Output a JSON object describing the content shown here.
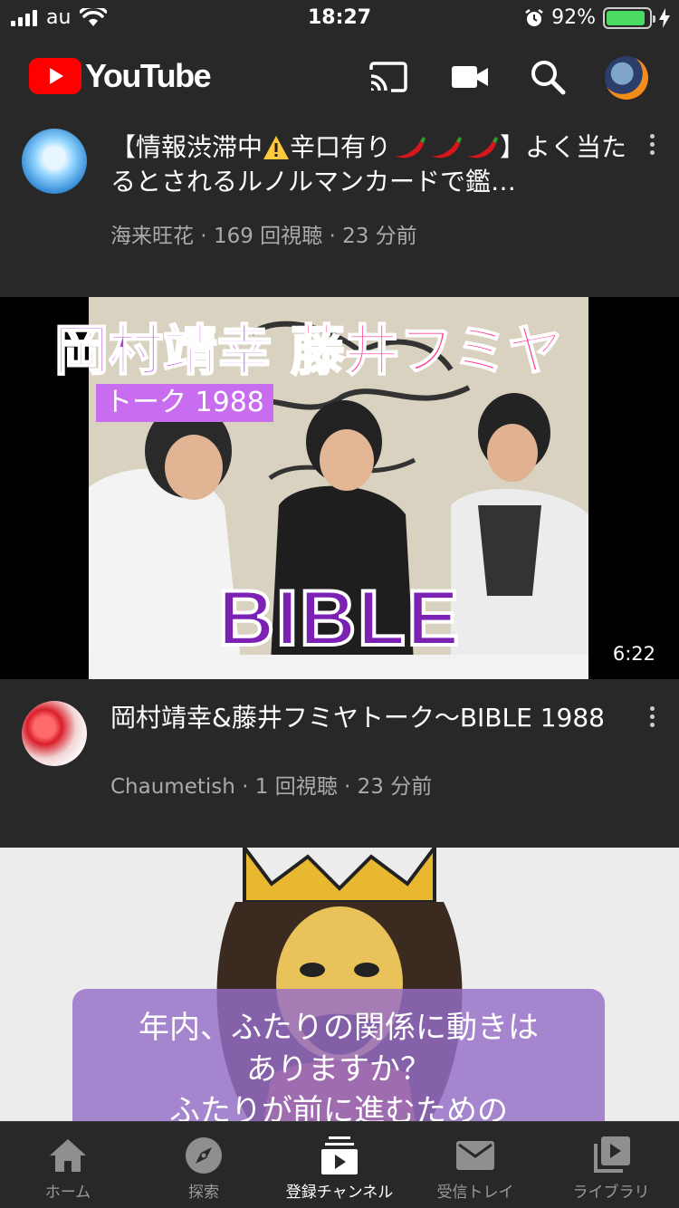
{
  "status_bar": {
    "carrier": "au",
    "time": "18:27",
    "battery_percent": "92%",
    "battery_level": 0.92
  },
  "header": {
    "logo_text": "YouTube",
    "icons": [
      "cast-icon",
      "camera-icon",
      "search-icon",
      "account-avatar"
    ]
  },
  "videos": [
    {
      "title_prefix": "【情報渋滞中",
      "title_mid": "辛口有り",
      "title_suffix": "】よく当たるとされるルノルマンカードで鑑…",
      "title_emoji_icons": [
        "warning-icon",
        "chili-pepper-icon"
      ],
      "channel": "海来旺花",
      "views": "169 回視聴",
      "age": "23 分前"
    },
    {
      "thumbnail": {
        "caption_name1": "岡村靖幸",
        "caption_name2": "藤井フミヤ",
        "caption_tag": "トーク 1988",
        "caption_big": "BIBLE",
        "duration": "6:22"
      },
      "title": "岡村靖幸&藤井フミヤトーク～BIBLE 1988",
      "channel": "Chaumetish",
      "views": "1 回視聴",
      "age": "23 分前"
    },
    {
      "thumbnail": {
        "caption_line1": "年内、ふたりの関係に動きは",
        "caption_line2": "ありますか？",
        "caption_line3": "ふたりが前に進むための"
      }
    }
  ],
  "separator": " · ",
  "bottom_nav": [
    {
      "label": "ホーム",
      "icon": "home-icon",
      "active": false
    },
    {
      "label": "探索",
      "icon": "compass-icon",
      "active": false
    },
    {
      "label": "登録チャンネル",
      "icon": "subscriptions-icon",
      "active": true
    },
    {
      "label": "受信トレイ",
      "icon": "mail-icon",
      "active": false
    },
    {
      "label": "ライブラリ",
      "icon": "library-icon",
      "active": false
    }
  ],
  "colors": {
    "background": "#282828",
    "youtube_red": "#ff0000",
    "secondary_text": "#aaaaaa",
    "battery_green": "#4cd964"
  }
}
